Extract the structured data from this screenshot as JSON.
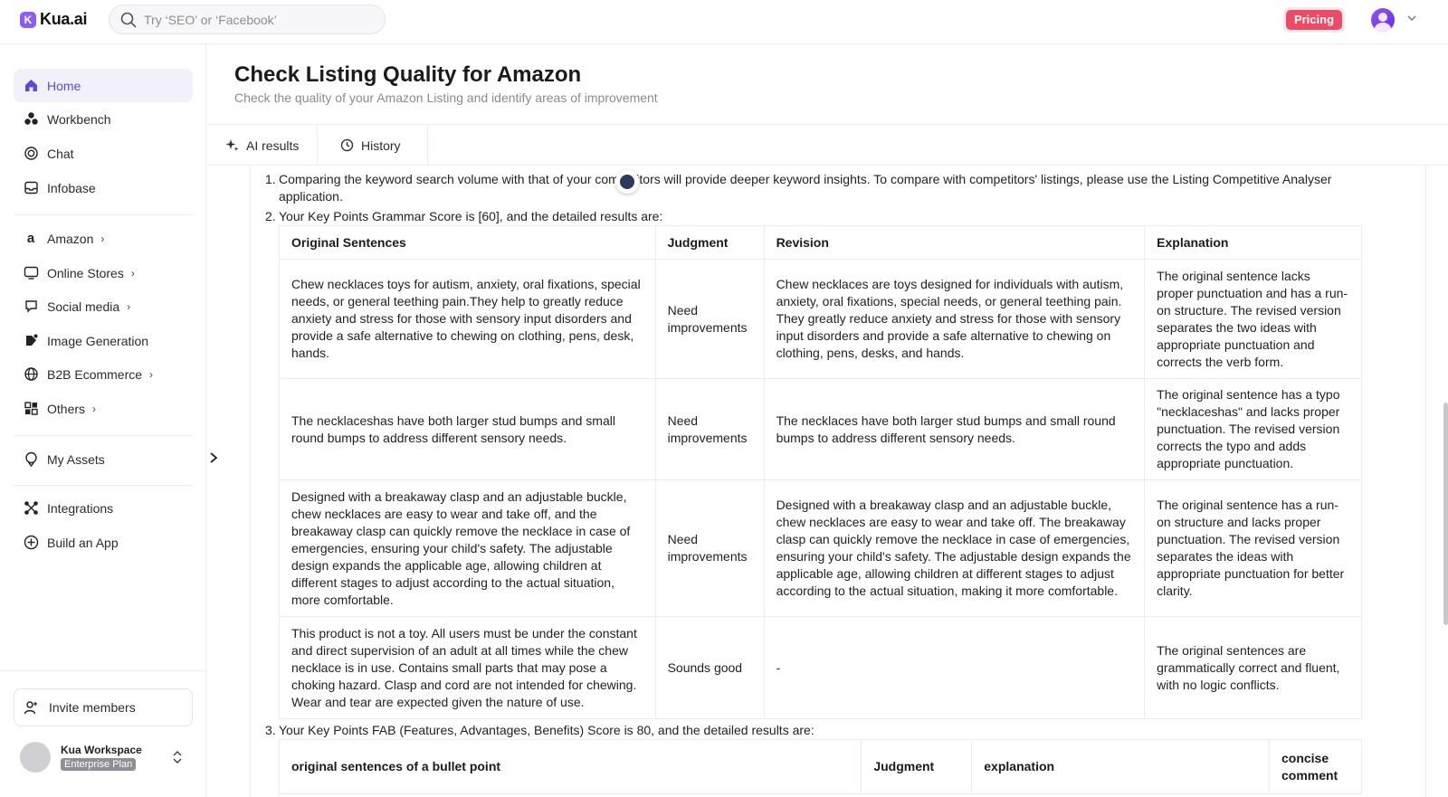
{
  "app": {
    "logo_mark": "K",
    "name": "Kua.ai"
  },
  "search": {
    "placeholder": "Try ‘SEO’ or ‘Facebook’"
  },
  "header": {
    "pricing_label": "Pricing"
  },
  "sidebar": {
    "items": [
      {
        "label": "Home",
        "icon": "home-icon"
      },
      {
        "label": "Workbench",
        "icon": "workbench-icon"
      },
      {
        "label": "Chat",
        "icon": "chat-icon"
      },
      {
        "label": "Infobase",
        "icon": "inbox-icon"
      },
      {
        "label": "Amazon",
        "icon": "amazon-icon"
      },
      {
        "label": "Online Stores",
        "icon": "monitor-icon"
      },
      {
        "label": "Social media",
        "icon": "social-icon"
      },
      {
        "label": "Image Generation",
        "icon": "image-gen-icon"
      },
      {
        "label": "B2B Ecommerce",
        "icon": "globe-icon"
      },
      {
        "label": "Others",
        "icon": "grid-icon"
      },
      {
        "label": "My Assets",
        "icon": "assets-icon"
      },
      {
        "label": "Integrations",
        "icon": "integrations-icon"
      },
      {
        "label": "Build an App",
        "icon": "plus-circle-icon"
      }
    ],
    "invite_label": "Invite members",
    "workspace": {
      "name": "Kua Workspace",
      "plan": "Enterprise Plan"
    }
  },
  "page": {
    "title": "Check Listing Quality for Amazon",
    "subtitle": "Check the quality of your Amazon Listing and identify areas of improvement",
    "tabs": [
      {
        "label": "AI results"
      },
      {
        "label": "History"
      }
    ]
  },
  "results": {
    "items": [
      {
        "num": "1.",
        "text": "Comparing the keyword search volume with that of your competitors will provide deeper keyword insights. To compare with competitors' listings, please use the Listing Competitive Analyser application."
      },
      {
        "num": "2.",
        "text": "Your Key Points Grammar Score is [60], and the detailed results are:"
      },
      {
        "num": "3.",
        "text": "Your Key Points FAB (Features, Advantages, Benefits) Score is 80, and the detailed results are:"
      }
    ],
    "grammar_table": {
      "headers": [
        "Original Sentences",
        "Judgment",
        "Revision",
        "Explanation"
      ],
      "rows": [
        {
          "original": "Chew necklaces toys for autism, anxiety, oral fixations, special needs, or general teething pain.They help to greatly reduce anxiety and stress for those with sensory input disorders and provide a safe alternative to chewing on clothing, pens, desk, hands.",
          "judgment": "Need improvements",
          "revision": "Chew necklaces are toys designed for individuals with autism, anxiety, oral fixations, special needs, or general teething pain. They greatly reduce anxiety and stress for those with sensory input disorders and provide a safe alternative to chewing on clothing, pens, desks, and hands.",
          "explanation": "The original sentence lacks proper punctuation and has a run-on structure. The revised version separates the two ideas with appropriate punctuation and corrects the verb form."
        },
        {
          "original": "The necklaceshas have both larger stud bumps and small round bumps to address different sensory needs.",
          "judgment": "Need improvements",
          "revision": "The necklaces have both larger stud bumps and small round bumps to address different sensory needs.",
          "explanation": "The original sentence has a typo \"necklaceshas\" and lacks proper punctuation. The revised version corrects the typo and adds appropriate punctuation."
        },
        {
          "original": "Designed with a breakaway clasp and an adjustable buckle, chew necklaces are easy to wear and take off, and the breakaway clasp can quickly remove the necklace in case of emergencies, ensuring your child's safety. The adjustable design expands the applicable age, allowing children at different stages to adjust according to the actual situation, more comfortable.",
          "judgment": "Need improvements",
          "revision": "Designed with a breakaway clasp and an adjustable buckle, chew necklaces are easy to wear and take off. The breakaway clasp can quickly remove the necklace in case of emergencies, ensuring your child's safety. The adjustable design expands the applicable age, allowing children at different stages to adjust according to the actual situation, making it more comfortable.",
          "explanation": "The original sentence has a run-on structure and lacks proper punctuation. The revised version separates the ideas with appropriate punctuation for better clarity."
        },
        {
          "original": "This product is not a toy. All users must be under the constant and direct supervision of an adult at all times while the chew necklace is in use. Contains small parts that may pose a choking hazard. Clasp and cord are not intended for chewing. Wear and tear are expected given the nature of use.",
          "judgment": "Sounds good",
          "revision": "-",
          "explanation": "The original sentences are grammatically correct and fluent, with no logic conflicts."
        }
      ]
    },
    "fab_table": {
      "headers": [
        "original sentences of a bullet point",
        "Judgment",
        "explanation",
        "concise comment"
      ]
    }
  },
  "colors": {
    "accent": "#5b4bd6",
    "pricing": "#ef4a64",
    "brand": "#8b5cf6"
  }
}
